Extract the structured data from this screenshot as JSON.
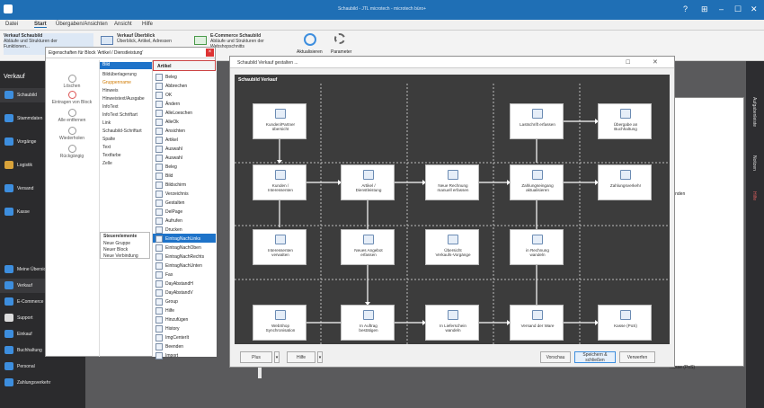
{
  "window": {
    "title": "Schaubild - JTL microtech - microtech büro+",
    "controls": [
      "?",
      "⊞",
      "–",
      "☐",
      "✕"
    ]
  },
  "menu": {
    "items": [
      "Datei",
      "Start",
      "Übergaben/Ansichten",
      "Ansicht",
      "Hilfe"
    ]
  },
  "ribbon": {
    "groups": [
      {
        "title": "Verkauf Schaubild",
        "lines": [
          "Abläufe und Strukturen der",
          "Funktionen..."
        ]
      },
      {
        "title": "Verkauf Überblick",
        "lines": [
          "Überblick, Artikel, Adressen"
        ]
      },
      {
        "title": "E-Commerce Schaubild",
        "lines": [
          "Abläufe und Strukturen der",
          "Webshopschnitts"
        ]
      }
    ],
    "actualize": "Aktualisieren",
    "params": "Parameter"
  },
  "leftnav": {
    "header": "Verkauf",
    "items": [
      {
        "label": "Schaubild",
        "sub": "Abläufe der Verk",
        "color": "#3d8ede"
      },
      {
        "label": "Stammdaten",
        "sub": "Überblick",
        "color": "#3d8ede"
      },
      {
        "label": "Vorgänge",
        "sub": "Angebote",
        "color": "#3d8ede"
      },
      {
        "label": "Logistik",
        "sub": "Versand",
        "color": "#d9a33a"
      },
      {
        "label": "Versand",
        "sub": "Abwicklung",
        "color": "#3d8ede"
      },
      {
        "label": "Kasse",
        "sub": "Kassenverw",
        "color": "#3d8ede"
      }
    ],
    "bottom": [
      "Meine Übersicht",
      "Verkauf",
      "E-Commerce",
      "Support",
      "Einkauf",
      "Buchhaltung",
      "Personal",
      "Zahlungsverkehr"
    ]
  },
  "right": {
    "tabs": [
      "Aufgabenleiste",
      "Notizen",
      "Hilfe"
    ]
  },
  "context": {
    "title": "Eigenschaften für Block 'Artikel / Dienstleistung'",
    "commands": [
      "Löschen",
      "Eintragen von Block",
      "Alle entfernen",
      "Wiederholen",
      "Rückgängig"
    ],
    "col1": [
      "Bild",
      "Bildüberlagerung",
      "Gruppenname",
      "Hinweis",
      "Hinweistext/Ausgabe",
      "InfoText",
      "InfoText Schriftart",
      "Link",
      "Schaubild-Schriftart",
      "Spalte",
      "Text",
      "Textfarbe",
      "Zelle"
    ],
    "col1_selected": "Bild",
    "steuer_title": "Steuerelemente",
    "steuer_items": [
      "Neue Gruppe",
      "Neuer Block",
      "Neue Verbindung"
    ],
    "col2_header": "Artikel",
    "col2": [
      "Beleg",
      "Abbrechen",
      "OK",
      "Ändern",
      "AlleLoeschen",
      "AlleOk",
      "Ansichten",
      "Artikel",
      "Auswahl",
      "Auswahl",
      "Beleg",
      "Bild",
      "Bildschirm",
      "Verzeichnis",
      "Gestalten",
      "DelPage",
      "Aufrufen",
      "Drucken",
      "EintragNachLinks",
      "EintragNachOben",
      "EintragNachRechts",
      "EintragNachUnten",
      "Fax",
      "DayAbstandH",
      "DayAbstandV",
      "Group",
      "Hilfe",
      "Hinzufügen",
      "History",
      "ImgCenterIt",
      "Beenden",
      "Import"
    ],
    "col2_highlight": "EintragNachLinks"
  },
  "schaubild": {
    "title": "Schaubild Verkauf gestalten ...",
    "canvas_caption": "Schaubild Verkauf",
    "nodes": [
      {
        "label": "Kunden/Partner\nübersicht",
        "icon": "hand-icon"
      },
      {
        "label": "Lastschrift erfassen",
        "icon": "document-icon"
      },
      {
        "label": "Übergabe an\nBuchhaltung",
        "icon": "ledger-icon"
      },
      {
        "label": "Kunden /\nInteressenten",
        "icon": "people-icon"
      },
      {
        "label": "Artikel /\nDienstleistung",
        "icon": "box-icon"
      },
      {
        "label": "Neue Rechnung\nmanuell erfassen",
        "icon": "invoice-icon"
      },
      {
        "label": "Zahlungseingang\naktualisieren",
        "icon": "globe-icon"
      },
      {
        "label": "Zahlungsverkehr",
        "icon": "truck-icon"
      },
      {
        "label": "Interessenten\nverwalten",
        "icon": "person-icon"
      },
      {
        "label": "Neues Angebot\nerfassen",
        "icon": "offer-icon"
      },
      {
        "label": "Übersicht\nVerkaufs-Vorgänge",
        "icon": "list-icon"
      },
      {
        "label": "in Rechnung\nwandeln",
        "icon": "convert-icon"
      },
      {
        "label": "WebShop\nSynchronisation",
        "icon": "sync-icon"
      },
      {
        "label": "In Auftrag\nbestätigen",
        "icon": "order-icon"
      },
      {
        "label": "In Lieferschein\nwandeln",
        "icon": "delivery-icon"
      },
      {
        "label": "Versand der Ware",
        "icon": "ship-icon"
      },
      {
        "label": "Kasse (PoS)",
        "icon": "cash-icon"
      }
    ],
    "footer": {
      "plus": "Plus",
      "hilfe": "Hilfe",
      "vorschau": "Vorschau",
      "save": "Speichern & schließen",
      "discard": "Verwerfen"
    }
  },
  "behind": {
    "labels": [
      "Kasse (PoS)",
      "Kunden"
    ]
  }
}
